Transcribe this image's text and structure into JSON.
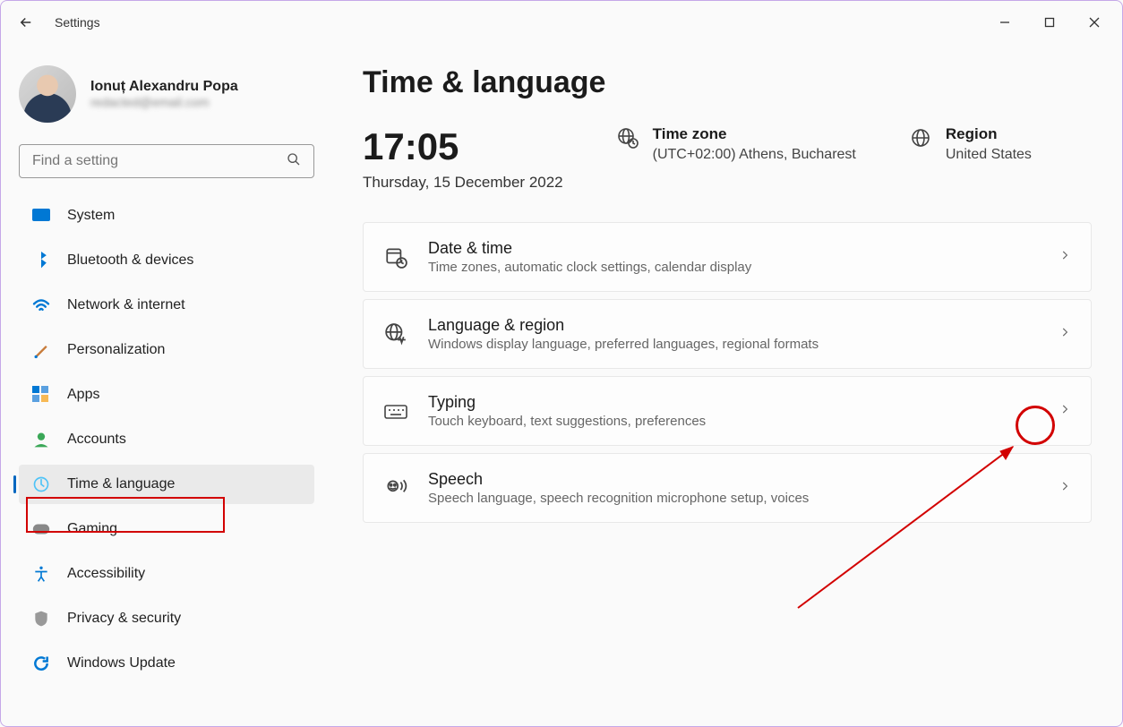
{
  "app_title": "Settings",
  "profile": {
    "name": "Ionuț Alexandru Popa",
    "email": "redacted@email.com"
  },
  "search_placeholder": "Find a setting",
  "sidebar": {
    "items": [
      {
        "label": "System"
      },
      {
        "label": "Bluetooth & devices"
      },
      {
        "label": "Network & internet"
      },
      {
        "label": "Personalization"
      },
      {
        "label": "Apps"
      },
      {
        "label": "Accounts"
      },
      {
        "label": "Time & language"
      },
      {
        "label": "Gaming"
      },
      {
        "label": "Accessibility"
      },
      {
        "label": "Privacy & security"
      },
      {
        "label": "Windows Update"
      }
    ],
    "active_index": 6
  },
  "page": {
    "title": "Time & language",
    "clock": {
      "time": "17:05",
      "date": "Thursday, 15 December 2022"
    },
    "timezone": {
      "label": "Time zone",
      "value": "(UTC+02:00) Athens, Bucharest"
    },
    "region": {
      "label": "Region",
      "value": "United States"
    },
    "cards": [
      {
        "title": "Date & time",
        "subtitle": "Time zones, automatic clock settings, calendar display"
      },
      {
        "title": "Language & region",
        "subtitle": "Windows display language, preferred languages, regional formats"
      },
      {
        "title": "Typing",
        "subtitle": "Touch keyboard, text suggestions, preferences"
      },
      {
        "title": "Speech",
        "subtitle": "Speech language, speech recognition microphone setup, voices"
      }
    ]
  }
}
